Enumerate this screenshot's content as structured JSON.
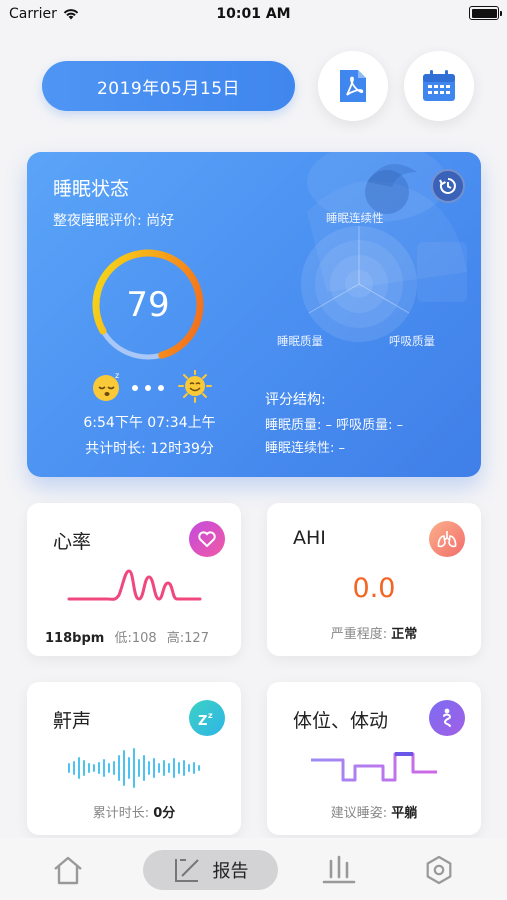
{
  "status_bar": {
    "carrier": "Carrier",
    "time": "10:01 AM"
  },
  "header": {
    "date": "2019年05月15日",
    "pdf_icon": "pdf-icon",
    "calendar_icon": "calendar-icon"
  },
  "sleep": {
    "title": "睡眠状态",
    "evaluation": "整夜睡眠评价: 尚好",
    "score": "79",
    "score_fraction": 0.79,
    "times": "6:54下午 07:34上午",
    "duration": "共计时长: 12时39分",
    "radar_labels": {
      "top": "睡眠连续性",
      "left": "睡眠质量",
      "right": "呼吸质量"
    },
    "structure_title": "评分结构:",
    "structure_line1": "睡眠质量: – 呼吸质量: –",
    "structure_line2": "睡眠连续性: –"
  },
  "heart": {
    "title": "心率",
    "bpm": "118bpm",
    "low": "低:108",
    "high": "高:127",
    "icon": "heart-icon"
  },
  "ahi": {
    "title": "AHI",
    "value": "0.0",
    "severity_label": "严重程度:",
    "severity": "正常",
    "icon": "lungs-icon"
  },
  "snore": {
    "title": "鼾声",
    "duration_label": "累计时长:",
    "duration": "0分",
    "icon": "zzz-icon"
  },
  "posture": {
    "title": "体位、体动",
    "suggest_label": "建议睡姿:",
    "suggest": "平躺",
    "icon": "person-icon"
  },
  "tabs": {
    "active_label": "报告",
    "items": [
      "home-icon",
      "report-icon",
      "stats-icon",
      "settings-icon"
    ]
  },
  "colors": {
    "accent": "#4a8ff1",
    "ahi_value": "#f26522",
    "heart_line": "#f0477e",
    "score_ring_start": "#f25f1f",
    "score_ring_end": "#f4e21a"
  }
}
